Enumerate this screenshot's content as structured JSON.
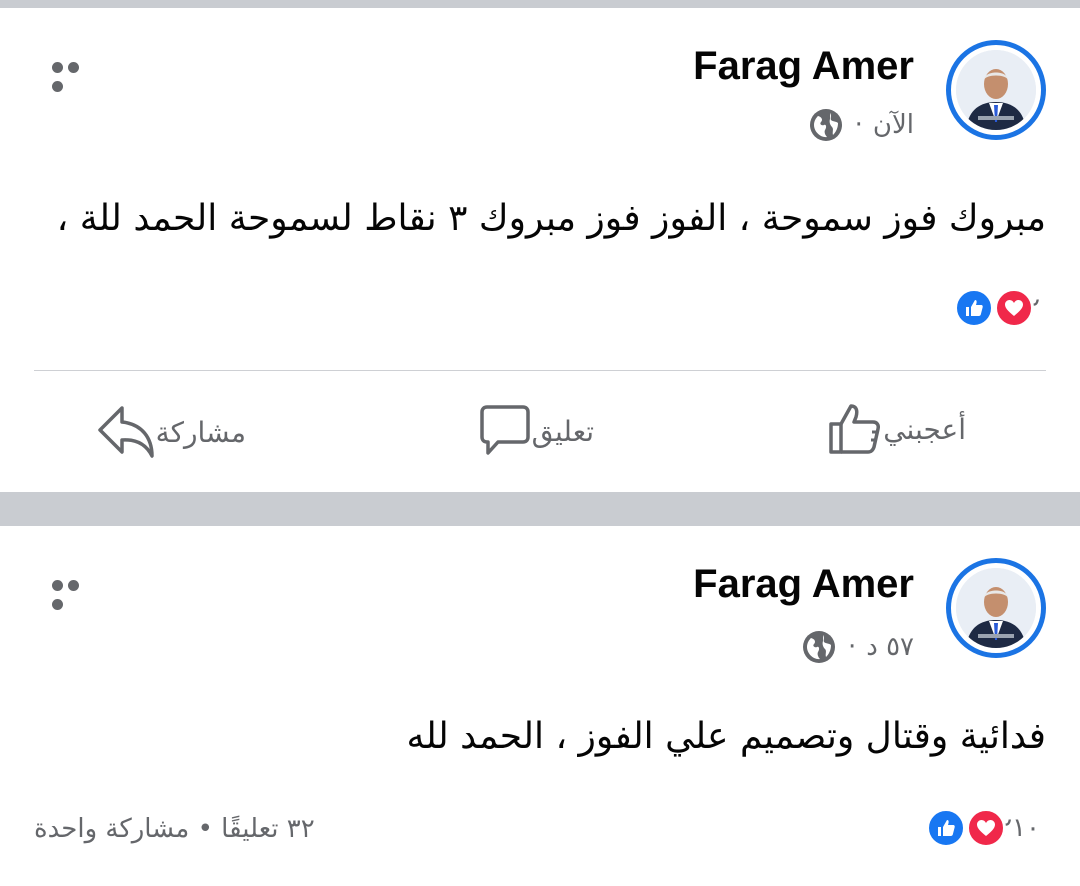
{
  "posts": [
    {
      "author": "Farag Amer",
      "time": "الآن",
      "separator": "·",
      "text": "مبروك فوز سموحة ، الفوز فوز مبروك ٣ نقاط لسموحة الحمد للة ،",
      "reaction_count": "٢",
      "actions": {
        "like": "أعجبني",
        "comment": "تعليق",
        "share": "مشاركة"
      }
    },
    {
      "author": "Farag Amer",
      "time": "٥٧ د",
      "separator": "·",
      "text": "فدائية وقتال وتصميم علي الفوز ، الحمد لله",
      "reaction_count": "٢١٠",
      "summary": "٣٢ تعليقًا • مشاركة واحدة"
    }
  ],
  "colors": {
    "accent": "#1877f2",
    "love": "#f0284a",
    "muted": "#65676b",
    "separator": "#c9ccd1"
  },
  "icons": [
    "globe-icon",
    "more-icon",
    "like-reaction-icon",
    "love-reaction-icon",
    "thumbs-up-icon",
    "comment-icon",
    "share-icon"
  ]
}
